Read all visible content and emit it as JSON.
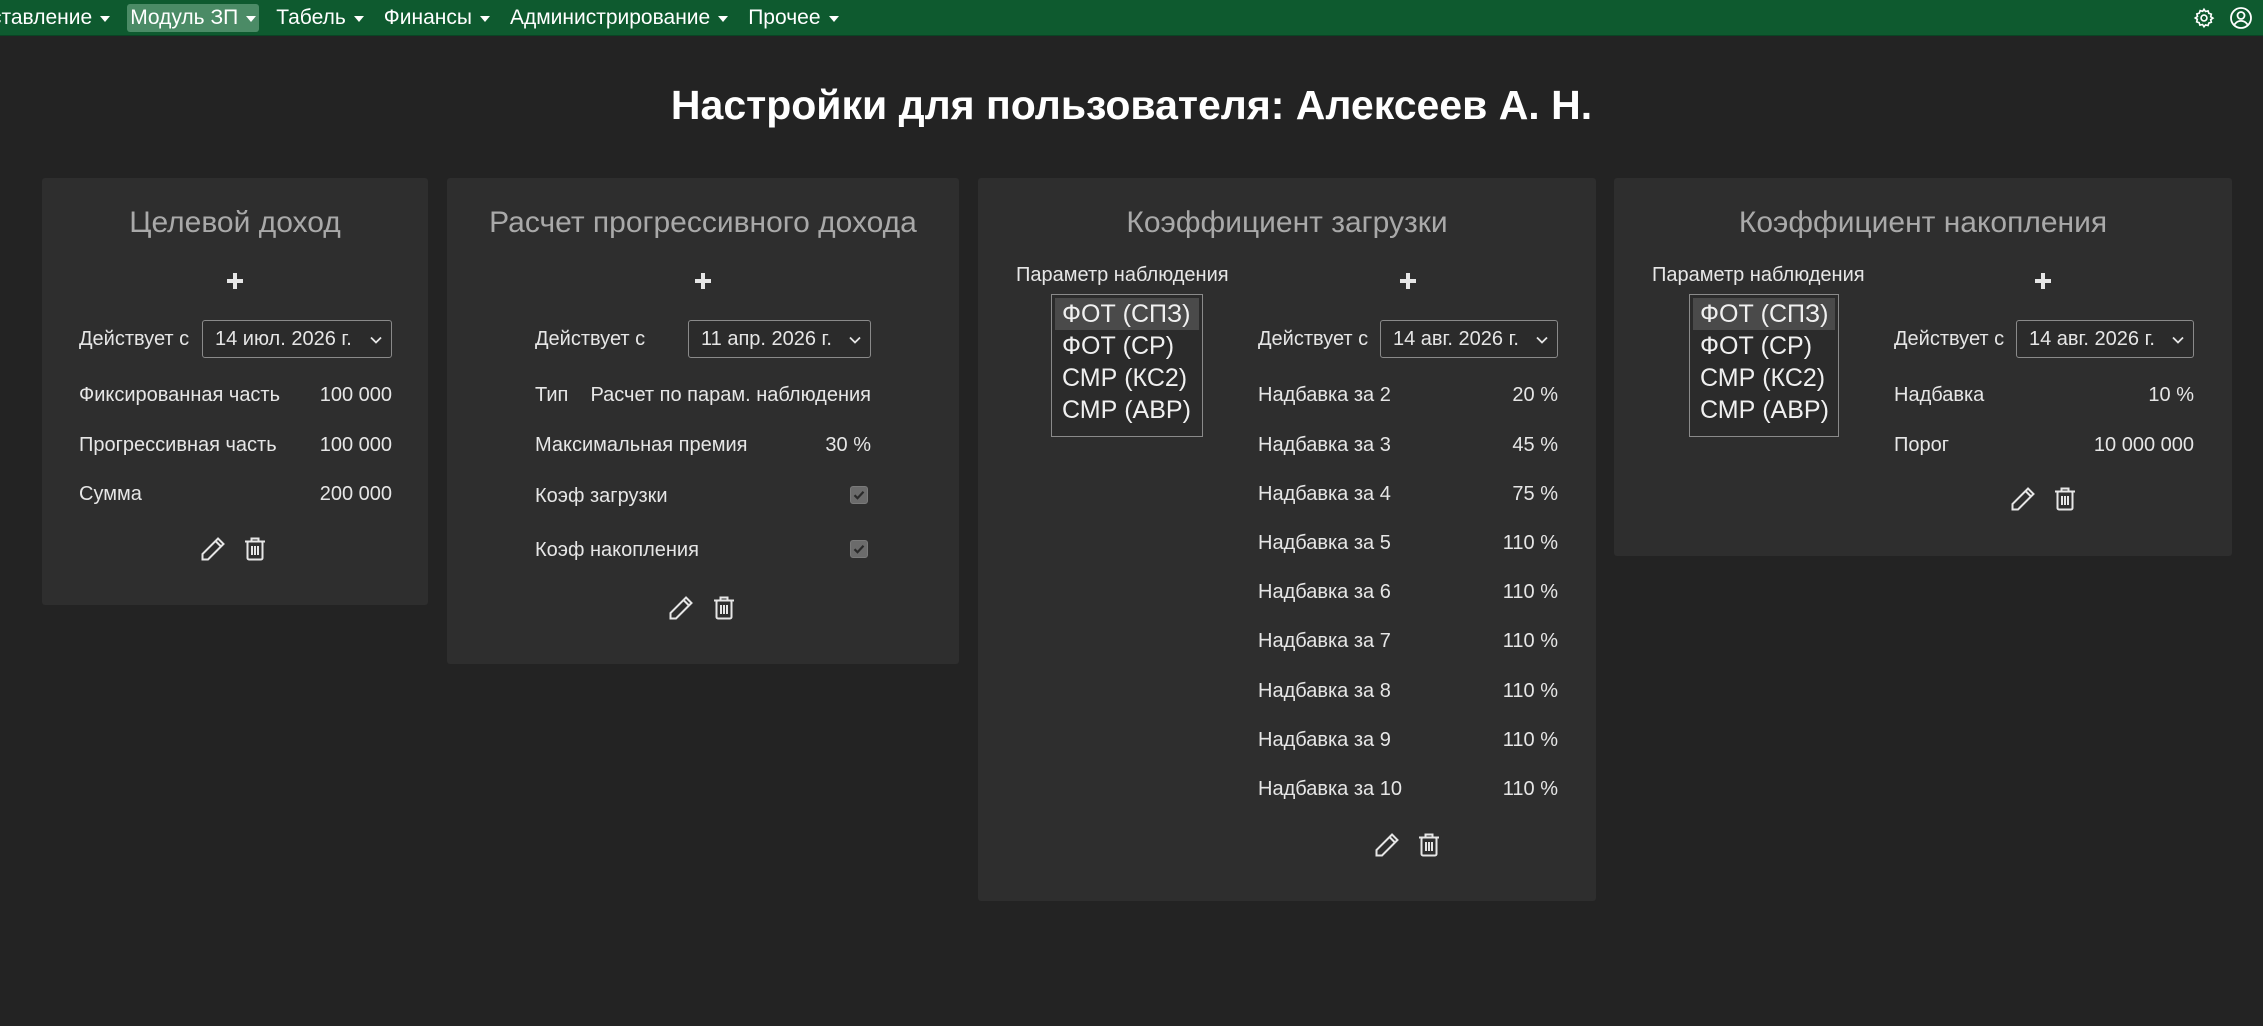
{
  "nav": {
    "items": [
      {
        "label": "ставление",
        "active": false
      },
      {
        "label": "Модуль ЗП",
        "active": true
      },
      {
        "label": "Табель",
        "active": false
      },
      {
        "label": "Финансы",
        "active": false
      },
      {
        "label": "Администрирование",
        "active": false
      },
      {
        "label": "Прочее",
        "active": false
      }
    ],
    "icons": [
      "gear-icon",
      "user-circle-icon"
    ]
  },
  "page_title": "Настройки для пользователя: Алексеев А. Н.",
  "target_income": {
    "title": "Целевой доход",
    "effective_label": "Действует с",
    "effective_date": "14 июл. 2026 г.",
    "rows": [
      {
        "label": "Фиксированная часть",
        "value": "100 000"
      },
      {
        "label": "Прогрессивная часть",
        "value": "100 000"
      },
      {
        "label": "Сумма",
        "value": "200 000"
      }
    ]
  },
  "progressive": {
    "title": "Расчет прогрессивного дохода",
    "effective_label": "Действует с",
    "effective_date": "11 апр. 2026 г.",
    "type_label": "Тип",
    "type_value": "Расчет по парам. наблюдения",
    "max_bonus_label": "Максимальная премия",
    "max_bonus_value": "30 %",
    "load_coef_label": "Коэф загрузки",
    "load_coef_checked": true,
    "accum_coef_label": "Коэф накопления",
    "accum_coef_checked": true
  },
  "load_coef": {
    "title": "Коэффициент загрузки",
    "param_label": "Параметр наблюдения",
    "params": [
      "ФОТ (СПЗ)",
      "ФОТ (СР)",
      "СМР (КС2)",
      "СМР (АВР)"
    ],
    "selected_param": "ФОТ (СПЗ)",
    "effective_label": "Действует с",
    "effective_date": "14 авг. 2026 г.",
    "rows": [
      {
        "label": "Надбавка за 2",
        "value": "20 %"
      },
      {
        "label": "Надбавка за 3",
        "value": "45 %"
      },
      {
        "label": "Надбавка за 4",
        "value": "75 %"
      },
      {
        "label": "Надбавка за 5",
        "value": "110 %"
      },
      {
        "label": "Надбавка за 6",
        "value": "110 %"
      },
      {
        "label": "Надбавка за 7",
        "value": "110 %"
      },
      {
        "label": "Надбавка за 8",
        "value": "110 %"
      },
      {
        "label": "Надбавка за 9",
        "value": "110 %"
      },
      {
        "label": "Надбавка за 10",
        "value": "110 %"
      }
    ]
  },
  "accum_coef": {
    "title": "Коэффициент накопления",
    "param_label": "Параметр наблюдения",
    "params": [
      "ФОТ (СПЗ)",
      "ФОТ (СР)",
      "СМР (КС2)",
      "СМР (АВР)"
    ],
    "selected_param": "ФОТ (СПЗ)",
    "effective_label": "Действует с",
    "effective_date": "14 авг. 2026 г.",
    "rows": [
      {
        "label": "Надбавка",
        "value": "10 %"
      },
      {
        "label": "Порог",
        "value": "10 000 000"
      }
    ]
  },
  "colors": {
    "navbar": "#0e5a2f",
    "background": "#232323",
    "card": "#2e2e2e"
  }
}
